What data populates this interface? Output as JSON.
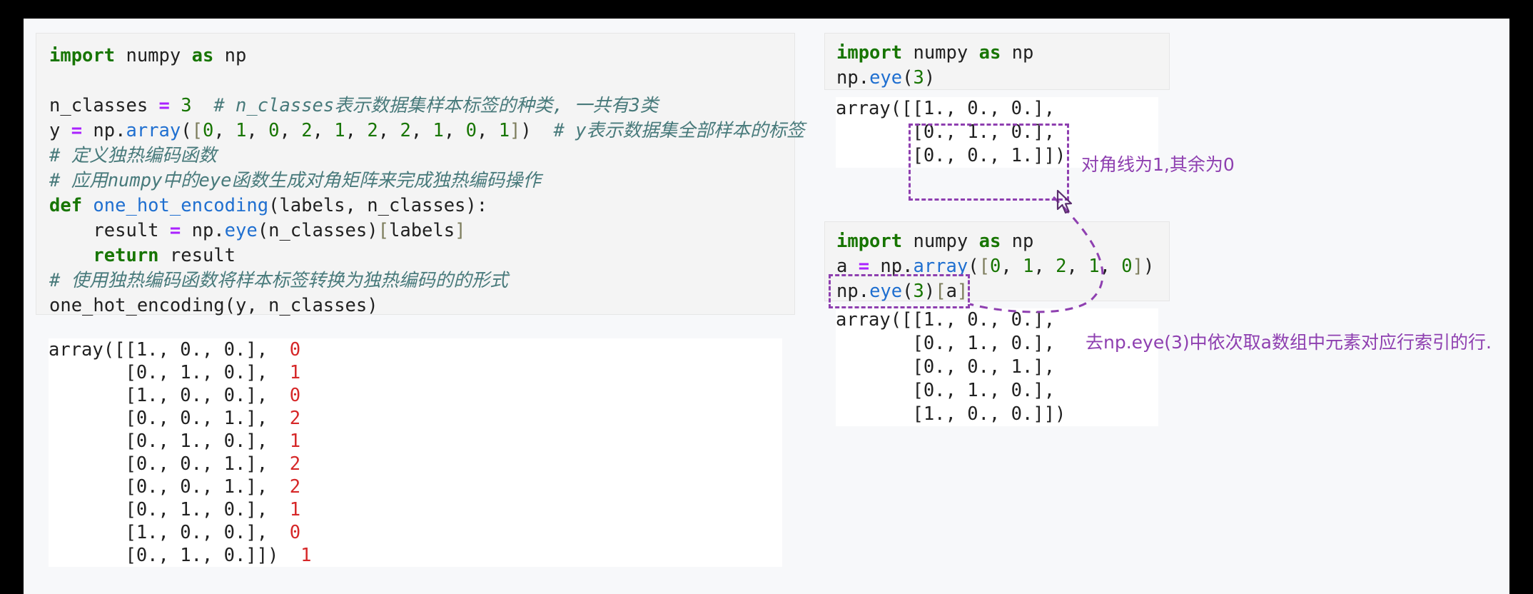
{
  "left": {
    "code_lines": [
      [
        {
          "t": "import ",
          "c": "kw"
        },
        {
          "t": "numpy ",
          "c": "plain"
        },
        {
          "t": "as ",
          "c": "kw"
        },
        {
          "t": "np",
          "c": "plain"
        }
      ],
      [],
      [
        {
          "t": "n_classes ",
          "c": "plain"
        },
        {
          "t": "=",
          "c": "op"
        },
        {
          "t": " ",
          "c": "plain"
        },
        {
          "t": "3",
          "c": "num"
        },
        {
          "t": "  ",
          "c": "plain"
        },
        {
          "t": "# n_classes表示数据集样本标签的种类, 一共有3类",
          "c": "cm"
        }
      ],
      [
        {
          "t": "y ",
          "c": "plain"
        },
        {
          "t": "=",
          "c": "op"
        },
        {
          "t": " np.",
          "c": "plain"
        },
        {
          "t": "array",
          "c": "fn"
        },
        {
          "t": "(",
          "c": "plain"
        },
        {
          "t": "[",
          "c": "brk"
        },
        {
          "t": "0",
          "c": "num"
        },
        {
          "t": ", ",
          "c": "plain"
        },
        {
          "t": "1",
          "c": "num"
        },
        {
          "t": ", ",
          "c": "plain"
        },
        {
          "t": "0",
          "c": "num"
        },
        {
          "t": ", ",
          "c": "plain"
        },
        {
          "t": "2",
          "c": "num"
        },
        {
          "t": ", ",
          "c": "plain"
        },
        {
          "t": "1",
          "c": "num"
        },
        {
          "t": ", ",
          "c": "plain"
        },
        {
          "t": "2",
          "c": "num"
        },
        {
          "t": ", ",
          "c": "plain"
        },
        {
          "t": "2",
          "c": "num"
        },
        {
          "t": ", ",
          "c": "plain"
        },
        {
          "t": "1",
          "c": "num"
        },
        {
          "t": ", ",
          "c": "plain"
        },
        {
          "t": "0",
          "c": "num"
        },
        {
          "t": ", ",
          "c": "plain"
        },
        {
          "t": "1",
          "c": "num"
        },
        {
          "t": "]",
          "c": "brk"
        },
        {
          "t": ")  ",
          "c": "plain"
        },
        {
          "t": "# y表示数据集全部样本的标签",
          "c": "cm"
        }
      ],
      [
        {
          "t": "# 定义独热编码函数",
          "c": "cm"
        }
      ],
      [
        {
          "t": "# 应用numpy中的eye函数生成对角矩阵来完成独热编码操作",
          "c": "cm"
        }
      ],
      [
        {
          "t": "def ",
          "c": "kw"
        },
        {
          "t": "one_hot_encoding",
          "c": "fn"
        },
        {
          "t": "(labels, n_classes):",
          "c": "plain"
        }
      ],
      [
        {
          "t": "    result ",
          "c": "plain"
        },
        {
          "t": "=",
          "c": "op"
        },
        {
          "t": " np.",
          "c": "plain"
        },
        {
          "t": "eye",
          "c": "fn"
        },
        {
          "t": "(n_classes)",
          "c": "plain"
        },
        {
          "t": "[",
          "c": "brk"
        },
        {
          "t": "labels",
          "c": "plain"
        },
        {
          "t": "]",
          "c": "brk"
        }
      ],
      [
        {
          "t": "    ",
          "c": "plain"
        },
        {
          "t": "return ",
          "c": "kw"
        },
        {
          "t": "result",
          "c": "plain"
        }
      ],
      [
        {
          "t": "# 使用独热编码函数将样本标签转换为独热编码的的形式",
          "c": "cm"
        }
      ],
      [
        {
          "t": "one_hot_encoding(y, n_classes)",
          "c": "plain"
        }
      ]
    ],
    "output_lines": [
      {
        "text": "array([[1., 0., 0.],",
        "label": "0"
      },
      {
        "text": "       [0., 1., 0.],",
        "label": "1"
      },
      {
        "text": "       [1., 0., 0.],",
        "label": "0"
      },
      {
        "text": "       [0., 0., 1.],",
        "label": "2"
      },
      {
        "text": "       [0., 1., 0.],",
        "label": "1"
      },
      {
        "text": "       [0., 0., 1.],",
        "label": "2"
      },
      {
        "text": "       [0., 0., 1.],",
        "label": "2"
      },
      {
        "text": "       [0., 1., 0.],",
        "label": "1"
      },
      {
        "text": "       [1., 0., 0.],",
        "label": "0"
      },
      {
        "text": "       [0., 1., 0.]])",
        "label": "1"
      }
    ]
  },
  "right_top": {
    "code_lines": [
      [
        {
          "t": "import ",
          "c": "kw"
        },
        {
          "t": "numpy ",
          "c": "plain"
        },
        {
          "t": "as ",
          "c": "kw"
        },
        {
          "t": "np",
          "c": "plain"
        }
      ],
      [
        {
          "t": "np.",
          "c": "plain"
        },
        {
          "t": "eye",
          "c": "fn"
        },
        {
          "t": "(",
          "c": "plain"
        },
        {
          "t": "3",
          "c": "num"
        },
        {
          "t": ")",
          "c": "plain"
        }
      ]
    ],
    "output_lines": [
      "array([[1., 0., 0.],",
      "       [0., 1., 0.],",
      "       [0., 0., 1.]])"
    ]
  },
  "right_bottom": {
    "code_lines": [
      [
        {
          "t": "import ",
          "c": "kw"
        },
        {
          "t": "numpy ",
          "c": "plain"
        },
        {
          "t": "as ",
          "c": "kw"
        },
        {
          "t": "np",
          "c": "plain"
        }
      ],
      [
        {
          "t": "a ",
          "c": "plain"
        },
        {
          "t": "=",
          "c": "op"
        },
        {
          "t": " np.",
          "c": "plain"
        },
        {
          "t": "array",
          "c": "fn"
        },
        {
          "t": "(",
          "c": "plain"
        },
        {
          "t": "[",
          "c": "brk"
        },
        {
          "t": "0",
          "c": "num"
        },
        {
          "t": ", ",
          "c": "plain"
        },
        {
          "t": "1",
          "c": "num"
        },
        {
          "t": ", ",
          "c": "plain"
        },
        {
          "t": "2",
          "c": "num"
        },
        {
          "t": ", ",
          "c": "plain"
        },
        {
          "t": "1",
          "c": "num"
        },
        {
          "t": ", ",
          "c": "plain"
        },
        {
          "t": "0",
          "c": "num"
        },
        {
          "t": "]",
          "c": "brk"
        },
        {
          "t": ")",
          "c": "plain"
        }
      ],
      [
        {
          "t": "np.",
          "c": "plain"
        },
        {
          "t": "eye",
          "c": "fn"
        },
        {
          "t": "(",
          "c": "plain"
        },
        {
          "t": "3",
          "c": "num"
        },
        {
          "t": ")",
          "c": "plain"
        },
        {
          "t": "[",
          "c": "brk"
        },
        {
          "t": "a",
          "c": "plain"
        },
        {
          "t": "]",
          "c": "brk"
        }
      ]
    ],
    "output_lines": [
      "array([[1., 0., 0.],",
      "       [0., 1., 0.],",
      "       [0., 0., 1.],",
      "       [0., 1., 0.],",
      "       [1., 0., 0.]])"
    ]
  },
  "annotations": {
    "diagonal": "对角线为1,其余为0",
    "rows": "去np.eye(3)中依次取a数组中元素对应行索引的行."
  },
  "colors": {
    "annotation_purple": "#8e3fb0",
    "keyword_green": "#177500",
    "function_blue": "#1f6fd0",
    "comment_teal": "#487a7b",
    "operator_purple": "#aa22ff",
    "label_red": "#d62728",
    "page_background": "#f7f8fa",
    "cell_background": "#f4f4f4",
    "outer_background": "#000000"
  }
}
